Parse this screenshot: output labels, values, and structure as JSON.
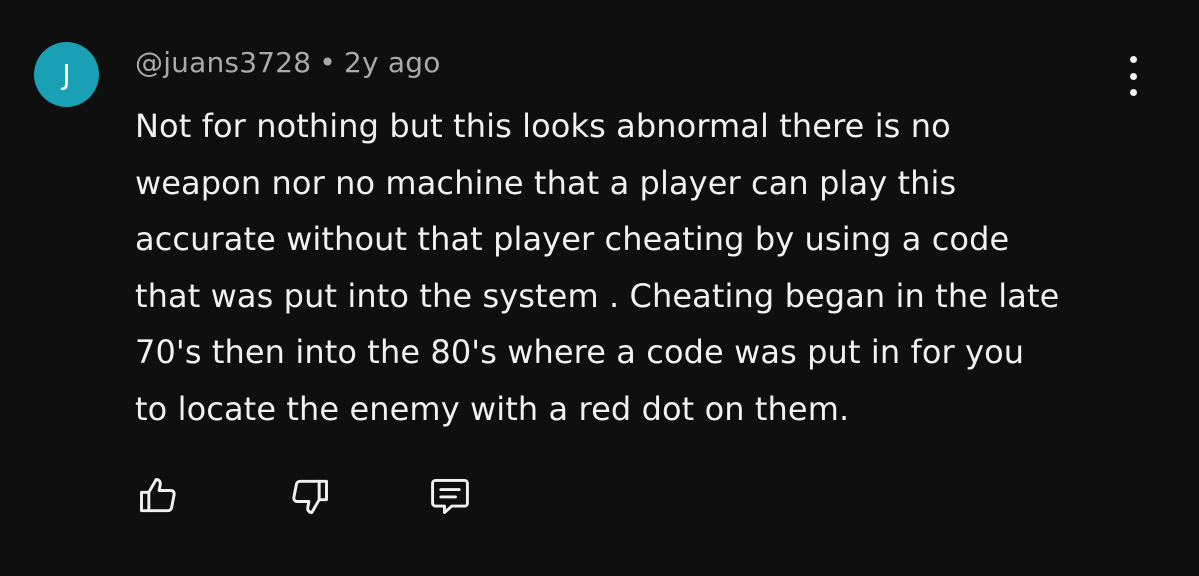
{
  "comment": {
    "avatar_initial": "J",
    "avatar_color": "#1aa0b5",
    "author": "@juans3728",
    "separator": "•",
    "timestamp": "2y ago",
    "text_lines": [
      "Not for nothing but this looks abnormal there is no",
      "weapon nor no machine that a player can play this",
      "accurate without that player cheating by using a code",
      "that was put into the system . Cheating began in the late",
      "70's then into the 80's where a code was put in for you",
      "to locate the enemy with a red dot on them."
    ]
  },
  "actions": {
    "like_icon": "thumbs-up-icon",
    "dislike_icon": "thumbs-down-icon",
    "reply_icon": "comment-icon",
    "more_icon": "more-vertical-icon"
  },
  "theme": {
    "background": "#0f0f0f",
    "text": "#f1f1f1",
    "meta_text": "#aaaaaa"
  }
}
